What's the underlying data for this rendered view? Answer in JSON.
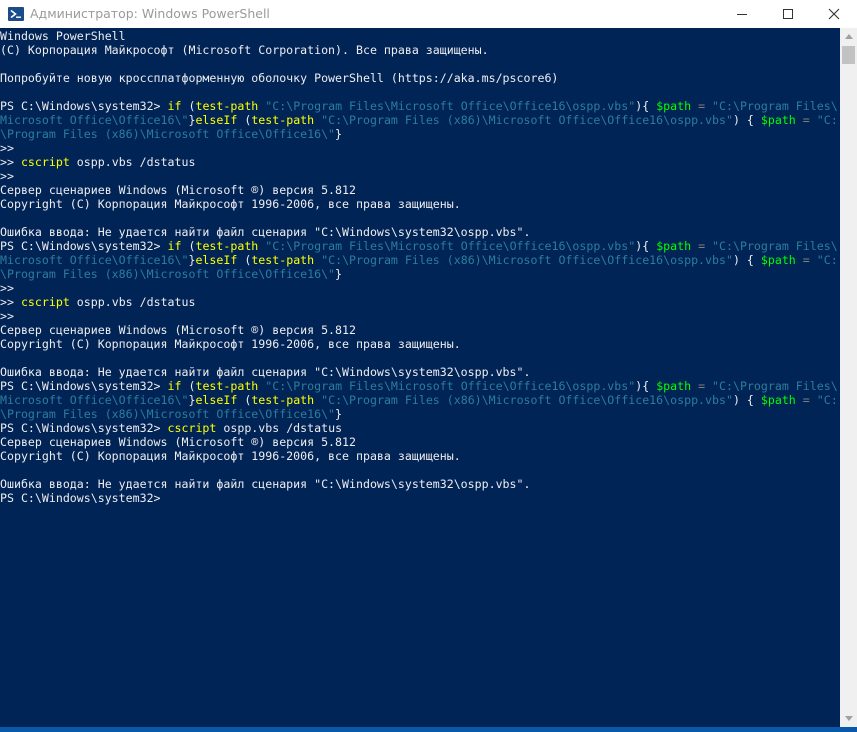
{
  "window": {
    "title": "Администратор: Windows PowerShell",
    "controls": {
      "minimize": "minimize-icon",
      "maximize": "maximize-icon",
      "close": "close-icon"
    }
  },
  "colors": {
    "background": "#012456",
    "text": "#eeedf0",
    "keyword": "#ffff00",
    "string": "#2c7d9b",
    "variable": "#00ff00",
    "operator": "#808080"
  },
  "console": {
    "lines": [
      [
        {
          "t": "text",
          "v": "Windows PowerShell"
        }
      ],
      [
        {
          "t": "text",
          "v": "(C) Корпорация Майкрософт (Microsoft Corporation). Все права защищены."
        }
      ],
      [],
      [
        {
          "t": "text",
          "v": "Попробуйте новую кроссплатформенную оболочку PowerShell (https://aka.ms/pscore6)"
        }
      ],
      [],
      [
        {
          "t": "text",
          "v": "PS C:\\Windows\\system32> "
        },
        {
          "t": "kw",
          "v": "if"
        },
        {
          "t": "text",
          "v": " ("
        },
        {
          "t": "cmd",
          "v": "test-path"
        },
        {
          "t": "text",
          "v": " "
        },
        {
          "t": "str",
          "v": "\"C:\\Program Files\\Microsoft Office\\Office16\\ospp.vbs\""
        },
        {
          "t": "text",
          "v": "){ "
        },
        {
          "t": "var",
          "v": "$path"
        },
        {
          "t": "text",
          "v": " "
        },
        {
          "t": "op",
          "v": "="
        },
        {
          "t": "text",
          "v": " "
        },
        {
          "t": "str",
          "v": "\"C:\\Program Files\\"
        }
      ],
      [
        {
          "t": "str",
          "v": "Microsoft Office\\Office16\\\""
        },
        {
          "t": "text",
          "v": "}"
        },
        {
          "t": "kw",
          "v": "elseIf"
        },
        {
          "t": "text",
          "v": " ("
        },
        {
          "t": "cmd",
          "v": "test-path"
        },
        {
          "t": "text",
          "v": " "
        },
        {
          "t": "str",
          "v": "\"C:\\Program Files (x86)\\Microsoft Office\\Office16\\ospp.vbs\""
        },
        {
          "t": "text",
          "v": ") { "
        },
        {
          "t": "var",
          "v": "$path"
        },
        {
          "t": "text",
          "v": " "
        },
        {
          "t": "op",
          "v": "="
        },
        {
          "t": "text",
          "v": " "
        },
        {
          "t": "str",
          "v": "\"C:"
        }
      ],
      [
        {
          "t": "str",
          "v": "\\Program Files (x86)\\Microsoft Office\\Office16\\\""
        },
        {
          "t": "text",
          "v": "}"
        }
      ],
      [
        {
          "t": "text",
          "v": ">>"
        }
      ],
      [
        {
          "t": "text",
          "v": ">> "
        },
        {
          "t": "cmd",
          "v": "cscript"
        },
        {
          "t": "text",
          "v": " ospp.vbs /dstatus"
        }
      ],
      [
        {
          "t": "text",
          "v": ">>"
        }
      ],
      [
        {
          "t": "text",
          "v": "Сервер сценариев Windows (Microsoft ®) версия 5.812"
        }
      ],
      [
        {
          "t": "text",
          "v": "Copyright (C) Корпорация Майкрософт 1996-2006, все права защищены."
        }
      ],
      [],
      [
        {
          "t": "text",
          "v": "Ошибка ввода: Не удается найти файл сценария \"C:\\Windows\\system32\\ospp.vbs\"."
        }
      ],
      [
        {
          "t": "text",
          "v": "PS C:\\Windows\\system32> "
        },
        {
          "t": "kw",
          "v": "if"
        },
        {
          "t": "text",
          "v": " ("
        },
        {
          "t": "cmd",
          "v": "test-path"
        },
        {
          "t": "text",
          "v": " "
        },
        {
          "t": "str",
          "v": "\"C:\\Program Files\\Microsoft Office\\Office16\\ospp.vbs\""
        },
        {
          "t": "text",
          "v": "){ "
        },
        {
          "t": "var",
          "v": "$path"
        },
        {
          "t": "text",
          "v": " "
        },
        {
          "t": "op",
          "v": "="
        },
        {
          "t": "text",
          "v": " "
        },
        {
          "t": "str",
          "v": "\"C:\\Program Files\\"
        }
      ],
      [
        {
          "t": "str",
          "v": "Microsoft Office\\Office16\\\""
        },
        {
          "t": "text",
          "v": "}"
        },
        {
          "t": "kw",
          "v": "elseIf"
        },
        {
          "t": "text",
          "v": " ("
        },
        {
          "t": "cmd",
          "v": "test-path"
        },
        {
          "t": "text",
          "v": " "
        },
        {
          "t": "str",
          "v": "\"C:\\Program Files (x86)\\Microsoft Office\\Office16\\ospp.vbs\""
        },
        {
          "t": "text",
          "v": ") { "
        },
        {
          "t": "var",
          "v": "$path"
        },
        {
          "t": "text",
          "v": " "
        },
        {
          "t": "op",
          "v": "="
        },
        {
          "t": "text",
          "v": " "
        },
        {
          "t": "str",
          "v": "\"C:"
        }
      ],
      [
        {
          "t": "str",
          "v": "\\Program Files (x86)\\Microsoft Office\\Office16\\\""
        },
        {
          "t": "text",
          "v": "}"
        }
      ],
      [
        {
          "t": "text",
          "v": ">>"
        }
      ],
      [
        {
          "t": "text",
          "v": ">> "
        },
        {
          "t": "cmd",
          "v": "cscript"
        },
        {
          "t": "text",
          "v": " ospp.vbs /dstatus"
        }
      ],
      [
        {
          "t": "text",
          "v": ">>"
        }
      ],
      [
        {
          "t": "text",
          "v": "Сервер сценариев Windows (Microsoft ®) версия 5.812"
        }
      ],
      [
        {
          "t": "text",
          "v": "Copyright (C) Корпорация Майкрософт 1996-2006, все права защищены."
        }
      ],
      [],
      [
        {
          "t": "text",
          "v": "Ошибка ввода: Не удается найти файл сценария \"C:\\Windows\\system32\\ospp.vbs\"."
        }
      ],
      [
        {
          "t": "text",
          "v": "PS C:\\Windows\\system32> "
        },
        {
          "t": "kw",
          "v": "if"
        },
        {
          "t": "text",
          "v": " ("
        },
        {
          "t": "cmd",
          "v": "test-path"
        },
        {
          "t": "text",
          "v": " "
        },
        {
          "t": "str",
          "v": "\"C:\\Program Files\\Microsoft Office\\Office16\\ospp.vbs\""
        },
        {
          "t": "text",
          "v": "){ "
        },
        {
          "t": "var",
          "v": "$path"
        },
        {
          "t": "text",
          "v": " "
        },
        {
          "t": "op",
          "v": "="
        },
        {
          "t": "text",
          "v": " "
        },
        {
          "t": "str",
          "v": "\"C:\\Program Files\\"
        }
      ],
      [
        {
          "t": "str",
          "v": "Microsoft Office\\Office16\\\""
        },
        {
          "t": "text",
          "v": "}"
        },
        {
          "t": "kw",
          "v": "elseIf"
        },
        {
          "t": "text",
          "v": " ("
        },
        {
          "t": "cmd",
          "v": "test-path"
        },
        {
          "t": "text",
          "v": " "
        },
        {
          "t": "str",
          "v": "\"C:\\Program Files (x86)\\Microsoft Office\\Office16\\ospp.vbs\""
        },
        {
          "t": "text",
          "v": ") { "
        },
        {
          "t": "var",
          "v": "$path"
        },
        {
          "t": "text",
          "v": " "
        },
        {
          "t": "op",
          "v": "="
        },
        {
          "t": "text",
          "v": " "
        },
        {
          "t": "str",
          "v": "\"C:"
        }
      ],
      [
        {
          "t": "str",
          "v": "\\Program Files (x86)\\Microsoft Office\\Office16\\\""
        },
        {
          "t": "text",
          "v": "}"
        }
      ],
      [
        {
          "t": "text",
          "v": "PS C:\\Windows\\system32> "
        },
        {
          "t": "cmd",
          "v": "cscript"
        },
        {
          "t": "text",
          "v": " ospp.vbs /dstatus"
        }
      ],
      [
        {
          "t": "text",
          "v": "Сервер сценариев Windows (Microsoft ®) версия 5.812"
        }
      ],
      [
        {
          "t": "text",
          "v": "Copyright (C) Корпорация Майкрософт 1996-2006, все права защищены."
        }
      ],
      [],
      [
        {
          "t": "text",
          "v": "Ошибка ввода: Не удается найти файл сценария \"C:\\Windows\\system32\\ospp.vbs\"."
        }
      ],
      [
        {
          "t": "text",
          "v": "PS C:\\Windows\\system32>"
        }
      ]
    ]
  }
}
